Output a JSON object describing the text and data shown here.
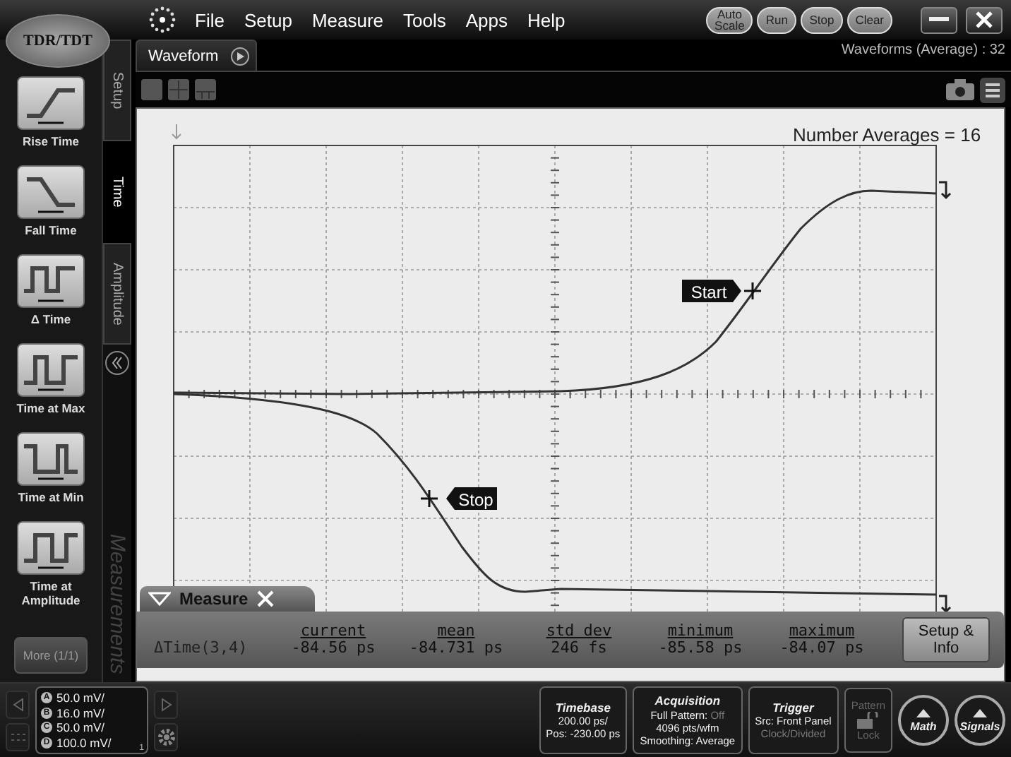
{
  "app": {
    "logo": "TDR/TDT"
  },
  "menu": [
    "File",
    "Setup",
    "Measure",
    "Tools",
    "Apps",
    "Help"
  ],
  "run_buttons": [
    {
      "label": "Auto Scale"
    },
    {
      "label": "Run"
    },
    {
      "label": "Stop"
    },
    {
      "label": "Clear"
    }
  ],
  "palette": {
    "items": [
      {
        "label": "Rise Time",
        "kind": "rise"
      },
      {
        "label": "Fall Time",
        "kind": "fall"
      },
      {
        "label": "Δ Time",
        "kind": "delta"
      },
      {
        "label": "Time at Max",
        "kind": "max"
      },
      {
        "label": "Time at Min",
        "kind": "min"
      },
      {
        "label": "Time at Amplitude",
        "kind": "amp"
      }
    ],
    "more_button": {
      "label": "More (1/1)",
      "disabled": true
    }
  },
  "side_tabs": [
    {
      "label": "Setup",
      "selected": false
    },
    {
      "label": "Time",
      "selected": true
    },
    {
      "label": "Amplitude",
      "selected": false
    }
  ],
  "side_caption": "Measurements",
  "waveform_tab": {
    "label": "Waveform"
  },
  "waveform_count": "Waveforms (Average) : 32",
  "plot": {
    "title": "Number Averages = 16",
    "markers": [
      {
        "label": "Start",
        "kind": "start"
      },
      {
        "label": "Stop",
        "kind": "stop"
      }
    ]
  },
  "measure_panel": {
    "title": "Measure",
    "columns": [
      "current",
      "mean",
      "std dev",
      "minimum",
      "maximum"
    ],
    "rows": [
      {
        "name": "ΔTime(3,4)",
        "values": [
          "-84.56 ps",
          "-84.731 ps",
          "246 fs",
          "-85.58 ps",
          "-84.07 ps"
        ]
      }
    ],
    "button": "Setup & Info"
  },
  "scales": [
    {
      "channel": "A",
      "value": "50.0 mV/"
    },
    {
      "channel": "B",
      "value": "16.0 mV/"
    },
    {
      "channel": "C",
      "value": "50.0 mV/"
    },
    {
      "channel": "D",
      "value": "100.0 mV/"
    }
  ],
  "scale_page": "1",
  "status_boxes": [
    {
      "title": "Timebase",
      "rows": [
        {
          "text": "200.00 ps/"
        },
        {
          "text": "Pos: -230.00 ps"
        }
      ]
    },
    {
      "title": "Acquisition",
      "rows": [
        {
          "text": "Full Pattern:",
          "value": "Off",
          "dimmed": true
        },
        {
          "text": "4096 pts/wfm"
        },
        {
          "text": "Smoothing:",
          "value": "Average"
        }
      ]
    },
    {
      "title": "Trigger",
      "rows": [
        {
          "text": "Src:",
          "value": "Front Panel"
        },
        {
          "text": "Clock/Divided",
          "dimmed": true
        }
      ]
    }
  ],
  "pattern_lock": {
    "title": "Pattern",
    "label": "Lock",
    "disabled": true
  },
  "round_buttons": [
    {
      "label": "Math"
    },
    {
      "label": "Signals"
    }
  ]
}
